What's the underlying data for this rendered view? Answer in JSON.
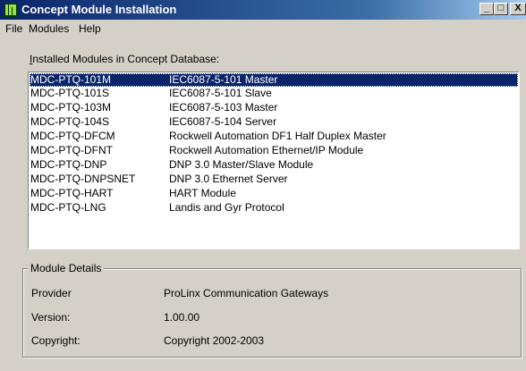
{
  "window": {
    "title": "Concept Module Installation",
    "controls": {
      "minimize": "_",
      "maximize": "□",
      "close": "X"
    }
  },
  "menu": {
    "items": [
      "File",
      "Modules",
      "Help"
    ]
  },
  "modules_list": {
    "label_underlined": "I",
    "label_rest": "nstalled Modules in Concept Database:",
    "selected_index": 0,
    "rows": [
      {
        "name": "MDC-PTQ-101M",
        "description": "IEC6087-5-101 Master"
      },
      {
        "name": "MDC-PTQ-101S",
        "description": "IEC6087-5-101 Slave"
      },
      {
        "name": "MDC-PTQ-103M",
        "description": "IEC6087-5-103 Master"
      },
      {
        "name": "MDC-PTQ-104S",
        "description": "IEC6087-5-104 Server"
      },
      {
        "name": "MDC-PTQ-DFCM",
        "description": "Rockwell Automation DF1 Half Duplex Master"
      },
      {
        "name": "MDC-PTQ-DFNT",
        "description": "Rockwell Automation Ethernet/IP Module"
      },
      {
        "name": "MDC-PTQ-DNP",
        "description": "DNP 3.0 Master/Slave Module"
      },
      {
        "name": "MDC-PTQ-DNPSNET",
        "description": "DNP 3.0 Ethernet Server"
      },
      {
        "name": "MDC-PTQ-HART",
        "description": "HART Module"
      },
      {
        "name": "MDC-PTQ-LNG",
        "description": "Landis and Gyr Protocol"
      }
    ]
  },
  "details": {
    "title": "Module Details",
    "provider_label": "Provider",
    "provider_value": "ProLinx Communication Gateways",
    "version_label": "Version:",
    "version_value": "1.00.00",
    "copyright_label": "Copyright:",
    "copyright_value": "Copyright 2002-2003"
  },
  "colors": {
    "titlebar": "#0a246a",
    "selection": "#0a246a",
    "face": "#d4d0c8"
  }
}
